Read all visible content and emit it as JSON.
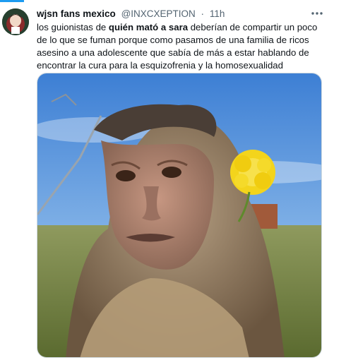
{
  "tweet": {
    "author": {
      "name": "wjsn fans mexico",
      "handle": "@INXCXEPTION",
      "separator": "·",
      "time": "11h"
    },
    "more_icon": "more-horizontal-icon",
    "text_before": "los guionistas de ",
    "text_bold": "quién mató a sara",
    "text_after": " deberían de compartir un poco de lo que se fuman porque como pasamos de una familia de ricos asesino a una adolescente que sabía de más a estar hablando de encontrar la cura para la esquizofrenia y la homosexualidad",
    "media": {
      "kind": "photo",
      "subject": "capuchin monkey with a yellow dandelion flower behind its ear"
    }
  },
  "colors": {
    "accent": "#1d9bf0",
    "secondary_text": "#536471",
    "primary_text": "#0f1419",
    "border": "#cfd9de"
  }
}
